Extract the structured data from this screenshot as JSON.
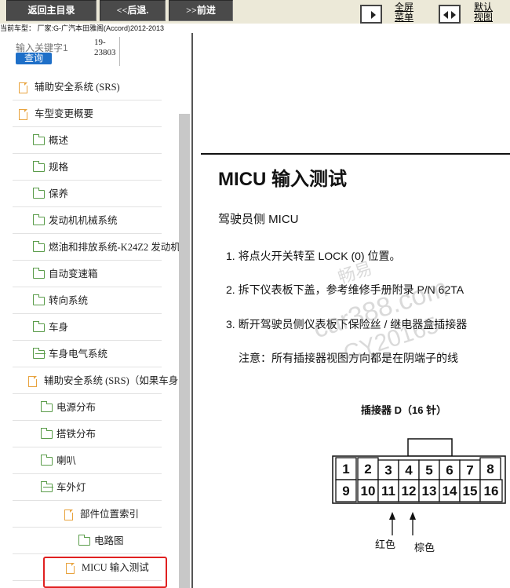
{
  "toolbar": {
    "home": "返回主目录",
    "back": "<<后退.",
    "forward": ">>前进",
    "fullscreen": [
      "全屏",
      "菜单"
    ],
    "default_view": [
      "默认",
      "视图"
    ]
  },
  "vehicle_info": "当前车型： 厂家:G-广汽本田雅阁(Accord)2012-2013",
  "search": {
    "placeholder": "输入关键字1",
    "button": "查询",
    "code": "19-23803"
  },
  "tree": [
    {
      "label": "辅助安全系统 (SRS)",
      "icon": "file"
    },
    {
      "label": "车型变更概要",
      "icon": "file"
    },
    {
      "label": "概述",
      "icon": "folder"
    },
    {
      "label": "规格",
      "icon": "folder"
    },
    {
      "label": "保养",
      "icon": "folder"
    },
    {
      "label": "发动机机械系统",
      "icon": "folder"
    },
    {
      "label": "燃油和排放系统-K24Z2 发动机",
      "icon": "folder"
    },
    {
      "label": "自动变速箱",
      "icon": "folder"
    },
    {
      "label": "转向系统",
      "icon": "folder"
    },
    {
      "label": "车身",
      "icon": "folder"
    },
    {
      "label": "车身电气系统",
      "icon": "folder-open"
    },
    {
      "label": "辅助安全系统 (SRS)（如果车身",
      "icon": "file"
    },
    {
      "label": "电源分布",
      "icon": "folder"
    },
    {
      "label": "搭铁分布",
      "icon": "folder"
    },
    {
      "label": "喇叭",
      "icon": "folder"
    },
    {
      "label": "车外灯",
      "icon": "folder-open"
    },
    {
      "label": "部件位置索引",
      "icon": "file"
    },
    {
      "label": "电路图",
      "icon": "folder"
    },
    {
      "label": "MICU 输入测试",
      "icon": "file"
    }
  ],
  "document": {
    "title": "MICU 输入测试",
    "subtitle": "驾驶员侧 MICU",
    "steps": [
      "1. 将点火开关转至 LOCK (0) 位置。",
      "2. 拆下仪表板下盖，参考维修手册附录 P/N 62TA",
      "3. 断开驾驶员侧仪表板下保险丝 / 继电器盒插接器"
    ],
    "note": "注意：所有插接器视图方向都是在阴端子的线",
    "connector": {
      "title": "插接器 D（16 针）",
      "top_row": [
        "1",
        "2",
        "3",
        "4",
        "5",
        "6",
        "7",
        "8"
      ],
      "bottom_row": [
        "9",
        "10",
        "11",
        "12",
        "13",
        "14",
        "15",
        "16"
      ],
      "wire_labels": [
        "红色",
        "棕色"
      ]
    }
  },
  "watermark": [
    "畅易",
    "car388.com",
    "CY20165"
  ]
}
